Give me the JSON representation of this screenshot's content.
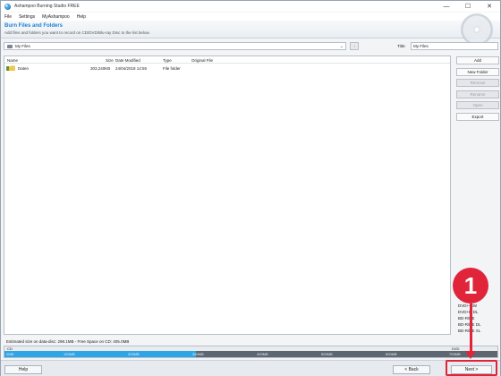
{
  "window": {
    "title": "Ashampoo Burning Studio FREE",
    "minimize": "—",
    "maximize": "☐",
    "close": "✕"
  },
  "menu": {
    "items": [
      "File",
      "Settings",
      "MyAshampoo",
      "Help"
    ]
  },
  "header": {
    "title": "Burn Files and Folders",
    "subtitle": "Add files and folders you want to record on CD/DVD/Blu-ray Disc to the list below."
  },
  "location": {
    "value": "My Files",
    "title_label": "Title:",
    "title_value": "My Files"
  },
  "table": {
    "columns": [
      "Name",
      "Size",
      "Date Modified",
      "Type",
      "Original File"
    ],
    "rows": [
      {
        "name": "Daten",
        "size": "303,240KB",
        "date": "24/04/2018 14:55",
        "type": "File folder",
        "original": ""
      }
    ]
  },
  "side_buttons": [
    {
      "label": "Add",
      "enabled": true
    },
    {
      "label": "New Folder",
      "enabled": true
    },
    {
      "label": "Remove",
      "enabled": false
    },
    {
      "label": "Rename",
      "enabled": false
    },
    {
      "label": "Open",
      "enabled": false
    },
    {
      "label": "Export",
      "enabled": true
    }
  ],
  "disc_types": [
    "DVD+-RW",
    "DVD+R DL",
    "BD-R/RE",
    "BD-R/RE DL",
    "BD-R/RE XL"
  ],
  "status": {
    "text": "Estimated size on data-disc: 298.1MB - Free Space on CD: 405.0MB"
  },
  "capacity": {
    "cd_label": "CD",
    "dvd_label": "DVD",
    "used_fraction": 0.388,
    "ticks": [
      "0MB",
      "100MB",
      "200MB",
      "300MB",
      "400MB",
      "500MB",
      "600MB",
      "700MB"
    ]
  },
  "bottom": {
    "help": "Help",
    "back": "< Back",
    "next": "Next >"
  },
  "annotation": {
    "badge": "1",
    "color": "#e0243a"
  },
  "colors": {
    "accent": "#1f7fcf",
    "bar_fill": "#2ea6e6"
  }
}
